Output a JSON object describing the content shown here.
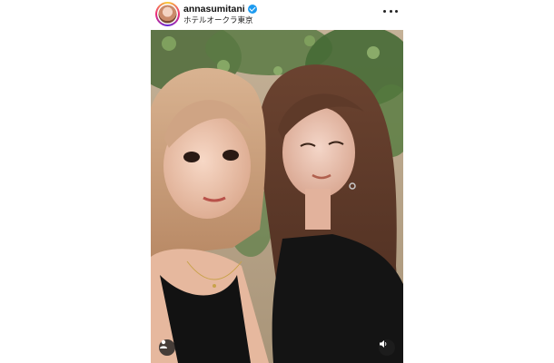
{
  "post": {
    "username": "annasumitani",
    "verified": true,
    "location": "ホテルオークラ東京"
  },
  "icons": {
    "more": "more-horizontal-icon",
    "user_tag": "user-tag-icon",
    "audio": "speaker-icon"
  },
  "colors": {
    "verified_badge": "#1d9bf0",
    "overlay_button": "#1e1e1e"
  }
}
